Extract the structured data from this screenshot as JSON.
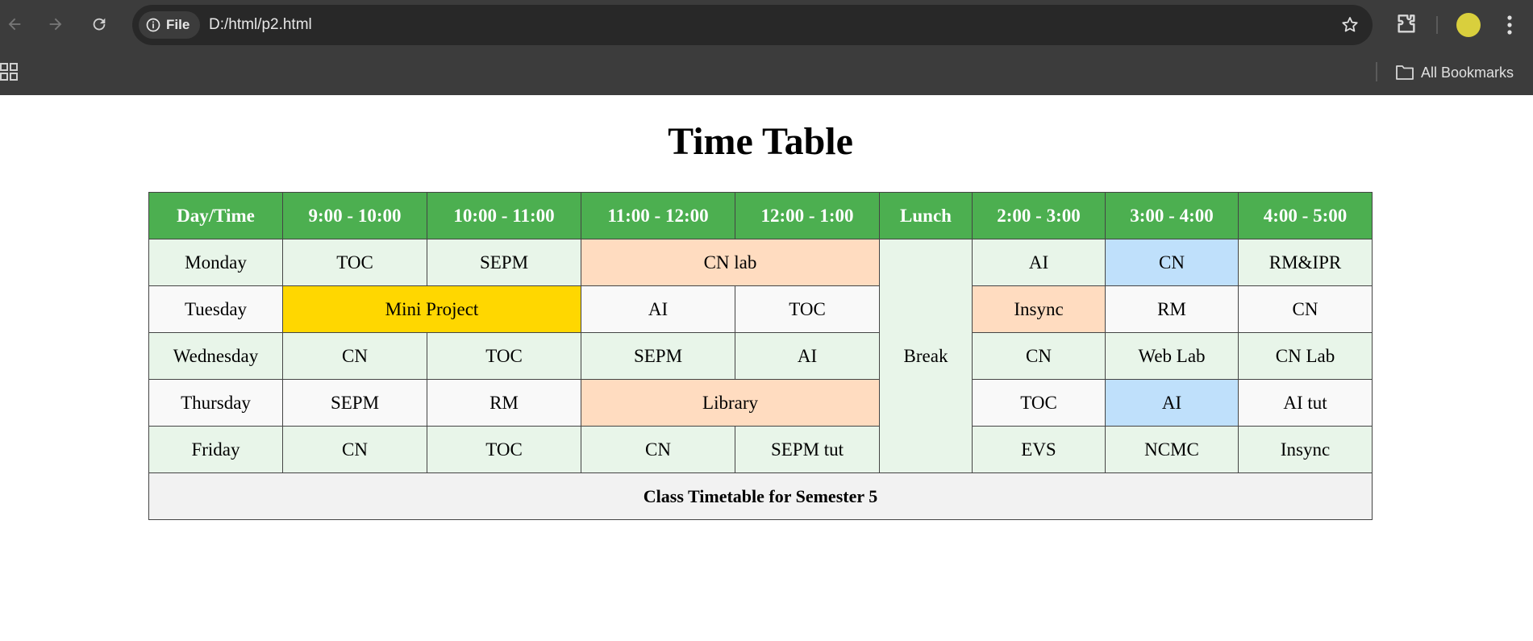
{
  "browser": {
    "file_chip_label": "File",
    "url": "D:/html/p2.html",
    "bookmarks_label": "All Bookmarks"
  },
  "page": {
    "title": "Time Table"
  },
  "timetable": {
    "headers": [
      "Day/Time",
      "9:00 - 10:00",
      "10:00 - 11:00",
      "11:00 - 12:00",
      "12:00 - 1:00",
      "Lunch",
      "2:00 - 3:00",
      "3:00 - 4:00",
      "4:00 - 5:00"
    ],
    "monday": {
      "day": "Monday",
      "s1": "TOC",
      "s2": "SEPM",
      "s34": "CN lab",
      "s6": "AI",
      "s7": "CN",
      "s8": "RM&IPR"
    },
    "tuesday": {
      "day": "Tuesday",
      "s12": "Mini Project",
      "s3": "AI",
      "s4": "TOC",
      "s6": "Insync",
      "s7": "RM",
      "s8": "CN"
    },
    "wednesday": {
      "day": "Wednesday",
      "s1": "CN",
      "s2": "TOC",
      "s3": "SEPM",
      "s4": "AI",
      "s6": "CN",
      "s7": "Web Lab",
      "s8": "CN Lab"
    },
    "thursday": {
      "day": "Thursday",
      "s1": "SEPM",
      "s2": "RM",
      "s34": "Library",
      "s6": "TOC",
      "s7": "AI",
      "s8": "AI tut"
    },
    "friday": {
      "day": "Friday",
      "s1": "CN",
      "s2": "TOC",
      "s3": "CN",
      "s4": "SEPM tut",
      "s6": "EVS",
      "s7": "NCMC",
      "s8": "Insync"
    },
    "lunch_cell": "Break",
    "footer": "Class Timetable for Semester 5"
  },
  "colors": {
    "header_green": "#4caf50",
    "row_green": "#e8f5e9",
    "row_grey": "#f9f9f9",
    "lab_peach": "#ffdcc0",
    "project_gold": "#ffd700",
    "highlight_blue": "#bfe0fb"
  }
}
